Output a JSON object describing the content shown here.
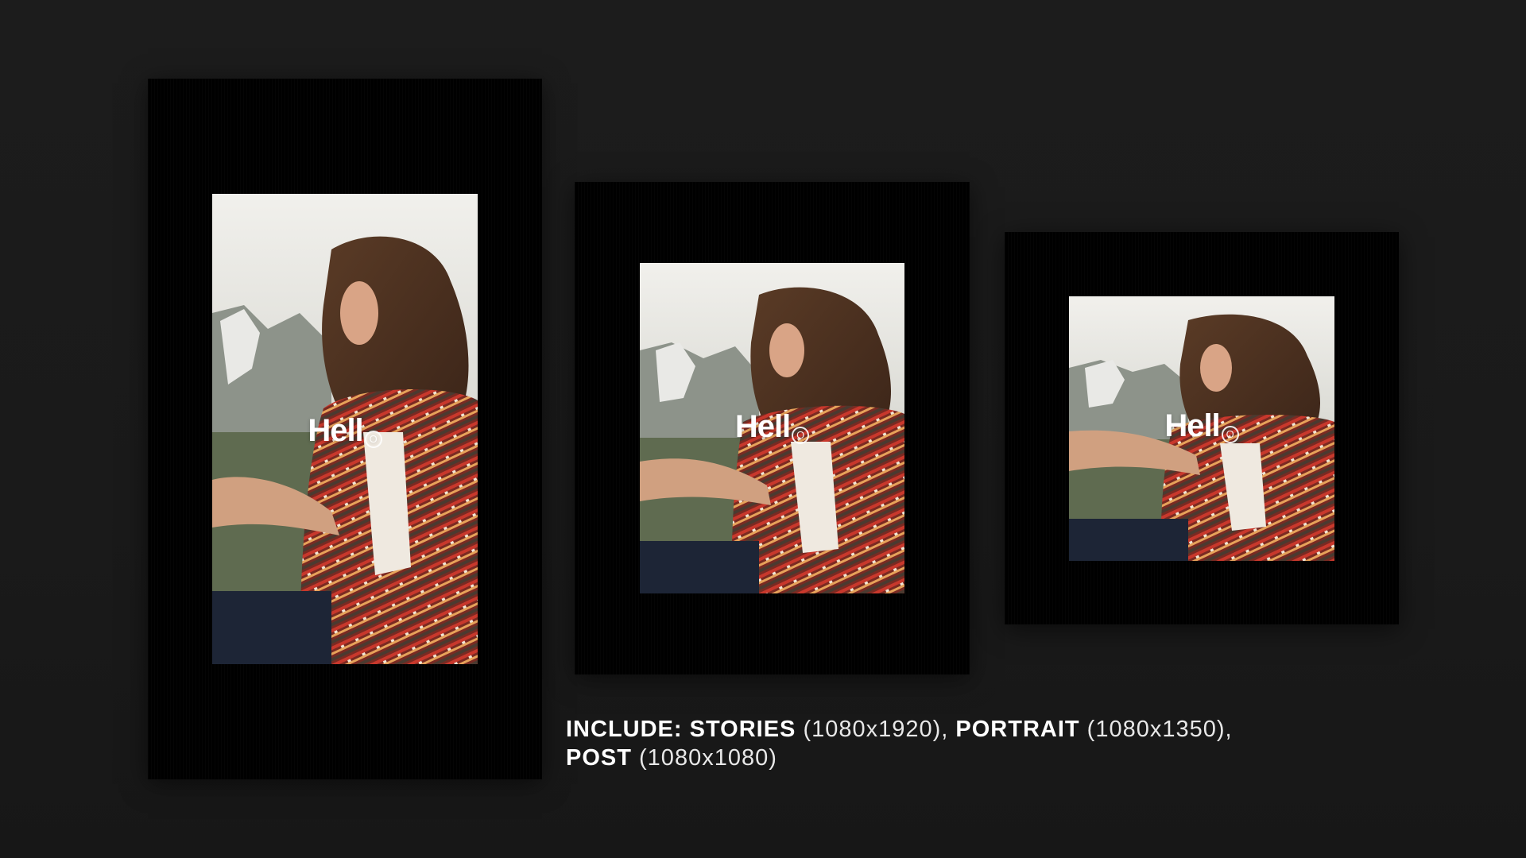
{
  "mockups": [
    {
      "name": "stories",
      "headline_text": "Hell",
      "headline_mark": "O"
    },
    {
      "name": "portrait",
      "headline_text": "Hell",
      "headline_mark": "O"
    },
    {
      "name": "post",
      "headline_text": "Hell",
      "headline_mark": "O"
    }
  ],
  "caption": {
    "line1_prefix": "INCLUDE: ",
    "stories_label": "STORIES",
    "stories_size": " (1080x1920), ",
    "portrait_label": "PORTRAIT",
    "portrait_size": " (1080x1350),",
    "post_label": "POST",
    "post_size": " (1080x1080)"
  },
  "colors": {
    "background": "#1c1c1c",
    "card": "#000000",
    "caption_text": "#e8e8e8"
  }
}
